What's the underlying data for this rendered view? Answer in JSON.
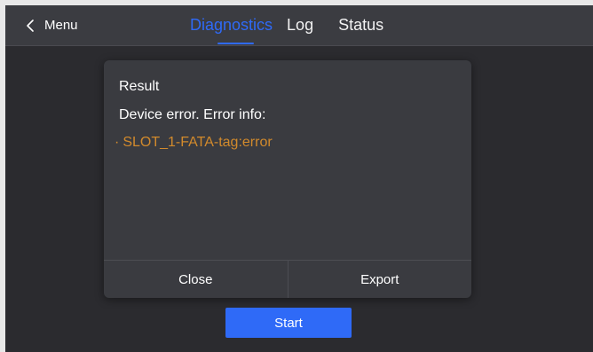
{
  "nav": {
    "back_label": "Menu",
    "tabs": [
      {
        "label": "Diagnostics",
        "active": true
      },
      {
        "label": "Log",
        "active": false
      },
      {
        "label": "Status",
        "active": false
      }
    ]
  },
  "dialog": {
    "title": "Result",
    "message": "Device error. Error info:",
    "errors": [
      {
        "bullet": "·",
        "text": "SLOT_1-FATA-tag:error"
      }
    ],
    "close_label": "Close",
    "export_label": "Export"
  },
  "start_label": "Start",
  "colors": {
    "accent": "#2f6af7",
    "error_text": "#d28a2c",
    "background": "#2b2b2f",
    "topbar": "#3b3c41",
    "dialog": "#3a3b40"
  },
  "icons": {
    "back": "chevron-left-icon"
  }
}
